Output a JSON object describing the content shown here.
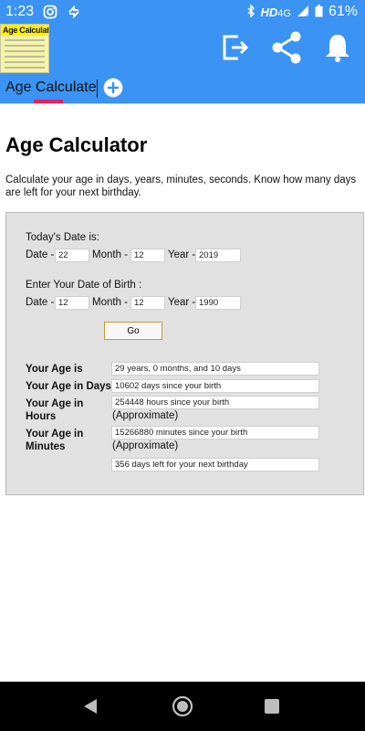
{
  "status_bar": {
    "time": "1:23",
    "network": "HD",
    "network_type": "4G",
    "battery": "61%",
    "icons": [
      "instagram-icon",
      "sync-icon",
      "bluetooth-icon",
      "signal-icon",
      "battery-icon"
    ]
  },
  "app_bar": {
    "logo_text": "Age Calculator",
    "icons": [
      "exit-icon",
      "share-icon",
      "bell-icon"
    ],
    "accent": "#3b93f3"
  },
  "tabs": [
    {
      "label": "Age Calculate",
      "active": true
    }
  ],
  "page": {
    "title": "Age Calculator",
    "description": "Calculate your age in days, years, minutes, seconds. Know how many days are left for your next birthday."
  },
  "form": {
    "today_heading": "Today's Date is:",
    "dob_heading": "Enter Your Date of Birth :",
    "date_label": "Date -",
    "month_label": "Month -",
    "year_label": "Year -",
    "today": {
      "date": "22",
      "month": "12",
      "year": "2019"
    },
    "dob": {
      "date": "12",
      "month": "12",
      "year": "1990"
    },
    "go_label": "Go"
  },
  "results": {
    "age_label": "Your Age is",
    "age_value": "29 years, 0 months, and 10 days",
    "days_label": "Your Age in Days",
    "days_value": "10602 days since your birth",
    "hours_label_1": "Your Age in",
    "hours_label_2": "Hours",
    "hours_value": "254448 hours since your birth",
    "minutes_label_1": "Your Age in",
    "minutes_label_2": "Minutes",
    "minutes_value": "15266880 minutes since your birth",
    "approx": "(Approximate)",
    "birthday_value": "356 days left for your next birthday"
  },
  "nav_bar": {
    "icons": [
      "back-icon",
      "home-icon",
      "recent-apps-icon"
    ]
  }
}
